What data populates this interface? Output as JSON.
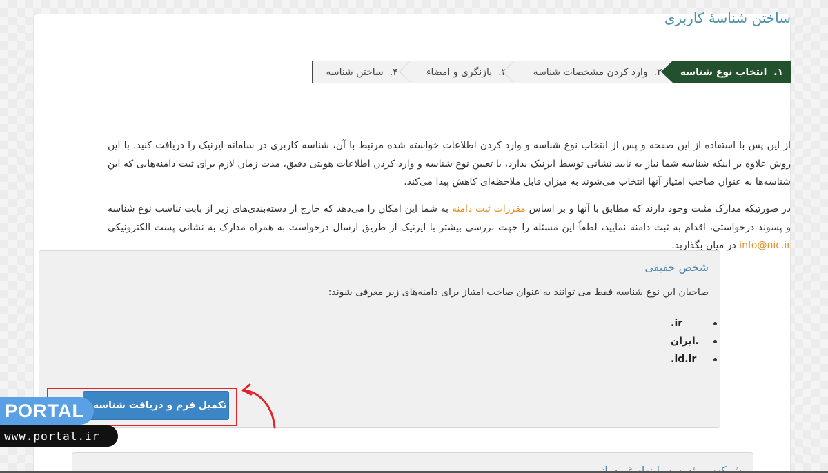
{
  "page": {
    "title": "ساختن شناسهٔ کاربری"
  },
  "steps": [
    {
      "number": "۱.",
      "label": "انتخاب نوع شناسه",
      "active": true
    },
    {
      "number": "۲.",
      "label": "وارد کردن مشخصات شناسه",
      "active": false
    },
    {
      "number": "۳.",
      "label": "بازنگری و امضاء",
      "active": false
    },
    {
      "number": "۴.",
      "label": "ساختن شناسه",
      "active": false
    }
  ],
  "intro": {
    "paragraph1": "از این پس با استفاده از این صفحه و پس از انتخاب نوع شناسه و وارد کردن اطلاعات خواسته شده مرتبط با آن، شناسه کاربری در سامانه ایرنیک را دریافت کنید. با این روش علاوه بر اینکه شناسه شما نیاز به تایید نشانی توسط ایرنیک ندارد، با تعیین نوع شناسه و وارد کردن اطلاعات هویتی دقیق، مدت زمان لازم برای ثبت دامنه‌هایی که این شناسه‌ها به عنوان صاحب امتیاز آنها انتخاب می‌شوند به میزان قابل ملاحظه‌ای کاهش پیدا می‌کند.",
    "paragraph2_before": "در صورتیکه مدارک مثبت وجود دارند که مطابق با آنها و بر اساس ",
    "paragraph2_link": "مقررات ثبت دامنه",
    "paragraph2_middle": " به شما این امکان را می‌دهد که خارج از دسته‌بندی‌های زیر از بابت تناسب نوع شناسه و پسوند درخواستی، اقدام به ثبت دامنه نمایید، لطفاً این مسئله را جهت بررسی بیشتر با ایرنیک از طریق ارسال درخواست به همراه مدارک به نشانی پست الکترونیکی ",
    "paragraph2_email": "info@nic.ir",
    "paragraph2_after": " در میان بگذارید."
  },
  "panel": {
    "title": "شخص حقیقی",
    "description": "صاحبان این نوع شناسه فقط می توانند به عنوان صاحب امتیاز برای دامنه‌های زیر معرفی شوند:",
    "domains": [
      ".ir",
      ".ایران",
      ".id.ir"
    ],
    "button_label": "تکمیل فرم و دریافت شناسه »"
  },
  "panel2": {
    "title": "شرکت، مؤسسه یا نهاد غیردولتی"
  },
  "watermark": {
    "brand": "PORTAL",
    "url": "www.portal.ir"
  },
  "colors": {
    "active_step": "#23502d",
    "title": "#4d92a8",
    "button": "#3d86c6",
    "link": "#e0912c",
    "highlight": "#e0242c"
  }
}
